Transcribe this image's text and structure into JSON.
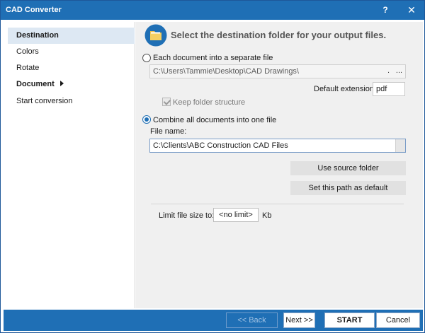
{
  "window": {
    "title": "CAD Converter",
    "help_label": "?",
    "close_label": "✕"
  },
  "sidebar": {
    "items": [
      {
        "label": "Destination"
      },
      {
        "label": "Colors"
      },
      {
        "label": "Rotate"
      },
      {
        "label": "Document"
      },
      {
        "label": "Start conversion"
      }
    ]
  },
  "main": {
    "heading": "Select the destination folder for your output files.",
    "separate": {
      "label": "Each document into a separate file",
      "path": "C:\\Users\\Tammie\\Desktop\\CAD Drawings\\",
      "browse_dot": ".",
      "browse_dots": "...",
      "default_ext_label": "Default extension:",
      "default_ext_value": "pdf",
      "keep_structure_label": "Keep folder structure"
    },
    "combine": {
      "label": "Combine all documents into one file",
      "file_name_label": "File name:",
      "file_name_value": "C:\\Clients\\ABC Construction CAD Files"
    },
    "use_source_label": "Use source folder",
    "set_default_label": "Set this path as default",
    "limit": {
      "label": "Limit file size to:",
      "value": "<no limit>",
      "unit": "Kb"
    }
  },
  "footer": {
    "back_label": "<< Back",
    "next_label": "Next >>",
    "start_label": "START",
    "cancel_label": "Cancel"
  },
  "colors": {
    "accent": "#1f6fb5",
    "nav_active": "#dde8f3",
    "panel": "#f0f0f0"
  }
}
